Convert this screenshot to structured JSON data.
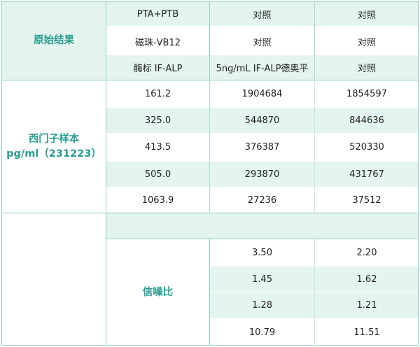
{
  "section1": {
    "label": "原始结果",
    "rows": [
      [
        "PTA+PTB",
        "对照",
        "对照"
      ],
      [
        "磁珠-VB12",
        "对照",
        "对照"
      ],
      [
        "酶标 IF-ALP",
        "5ng/mL IF-ALP德奥平",
        "对照"
      ]
    ]
  },
  "section2": {
    "label_line1": "西门子样本",
    "label_line2": "pg/ml（231223）",
    "rows": [
      [
        "161.2",
        "1904684",
        "1854597"
      ],
      [
        "325.0",
        "544870",
        "844636"
      ],
      [
        "413.5",
        "376387",
        "520330"
      ],
      [
        "505.0",
        "293870",
        "431767"
      ],
      [
        "1063.9",
        "27236",
        "37512"
      ]
    ]
  },
  "section3": {
    "label": "信噪比",
    "rows": [
      [
        "3.50",
        "2.20"
      ],
      [
        "1.45",
        "1.62"
      ],
      [
        "1.28",
        "1.21"
      ],
      [
        "10.79",
        "11.51"
      ]
    ]
  },
  "colors": {
    "accent": "#2a9d8f",
    "tint": "#e4f4ee",
    "border": "#8fd1c0"
  }
}
